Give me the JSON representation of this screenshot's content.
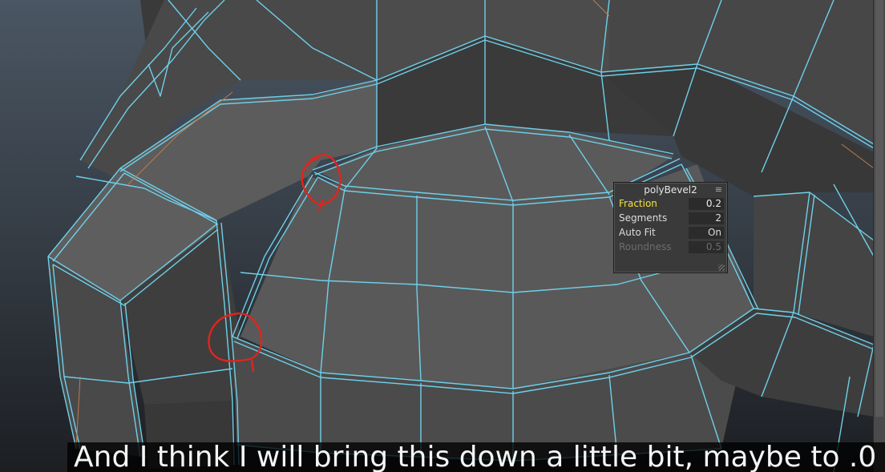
{
  "viewport": {
    "background_top": "#46525f",
    "background_bottom": "#1e2024",
    "wire_color": "#6ed0ea",
    "annotation_color": "#e0251c"
  },
  "channel_box": {
    "node_name": "polyBevel2",
    "menu_icon": "≡",
    "attributes": [
      {
        "label": "Fraction",
        "value": "0.2",
        "state": "active"
      },
      {
        "label": "Segments",
        "value": "2",
        "state": "normal"
      },
      {
        "label": "Auto Fit",
        "value": "On",
        "state": "normal"
      },
      {
        "label": "Roundness",
        "value": "0.5",
        "state": "dim"
      }
    ]
  },
  "subtitle": {
    "text": "And I think I will bring this down a little bit, maybe to .0"
  }
}
